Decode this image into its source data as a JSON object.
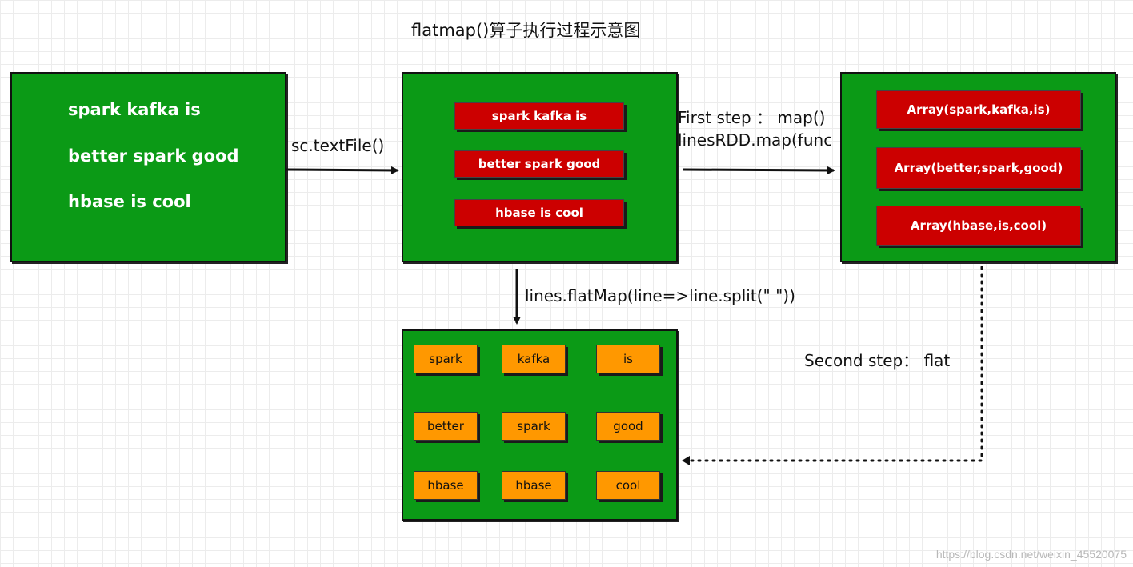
{
  "title": "flatmap()算子执行过程示意图",
  "source_box": {
    "lines": [
      "spark kafka is",
      "better spark good",
      "hbase is cool"
    ]
  },
  "lines_box": {
    "items": [
      "spark kafka is",
      "better spark good",
      "hbase is cool"
    ]
  },
  "arrays_box": {
    "items": [
      "Array(spark,kafka,is)",
      "Array(better,spark,good)",
      "Array(hbase,is,cool)"
    ]
  },
  "words_box": {
    "words": [
      "spark",
      "kafka",
      "is",
      "better",
      "spark",
      "good",
      "hbase",
      "hbase",
      "cool"
    ]
  },
  "labels": {
    "textfile": "sc.textFile()",
    "first_step_line1": "First step ：  map()",
    "first_step_line2": "linesRDD.map(func",
    "flatmap_call": "lines.flatMap(line=>line.split(\" \"))",
    "second_step": "Second step：  flat"
  },
  "watermark": "https://blog.csdn.net/weixin_45520075",
  "colors": {
    "box_green": "#0b9a16",
    "box_red": "#cc0000",
    "box_orange": "#ff9800"
  }
}
